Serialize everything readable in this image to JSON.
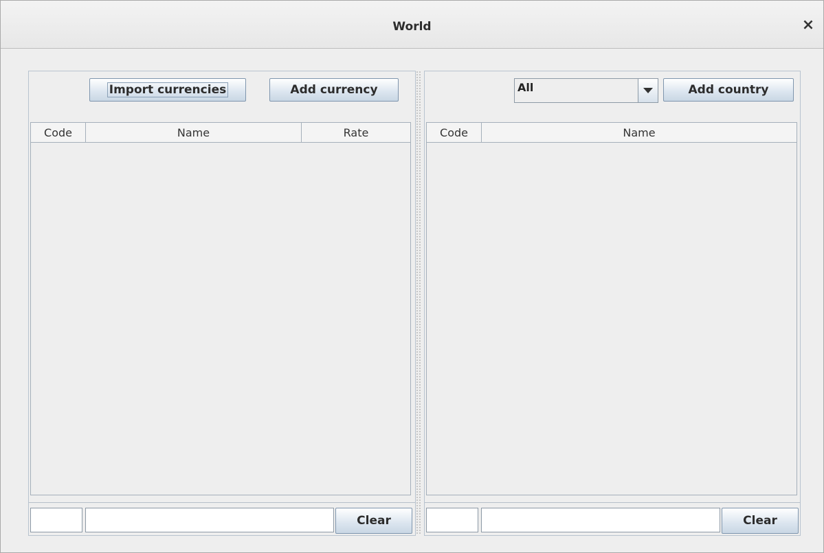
{
  "window": {
    "title": "World",
    "close_label": "×"
  },
  "currencies": {
    "import_label": "Import currencies",
    "add_label": "Add currency",
    "columns": [
      "Code",
      "Name",
      "Rate"
    ],
    "filter_code": "",
    "filter_text": "",
    "clear_label": "Clear"
  },
  "countries": {
    "filter_value": "All",
    "add_label": "Add country",
    "columns": [
      "Code",
      "Name"
    ],
    "filter_code": "",
    "filter_text": "",
    "clear_label": "Clear"
  }
}
